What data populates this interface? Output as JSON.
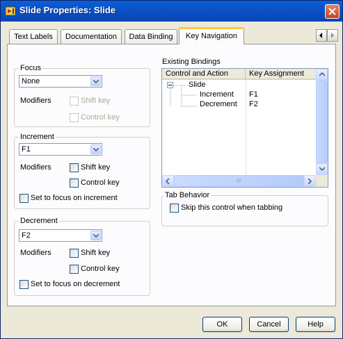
{
  "window": {
    "title": "Slide Properties: Slide"
  },
  "tabs": [
    {
      "label": "Text Labels"
    },
    {
      "label": "Documentation"
    },
    {
      "label": "Data Binding"
    },
    {
      "label": "Key Navigation",
      "selected": true
    }
  ],
  "focus": {
    "label": "Focus",
    "select_value": "None",
    "modifiers_label": "Modifiers",
    "shift_key": "Shift key",
    "control_key": "Control key"
  },
  "increment": {
    "label": "Increment",
    "select_value": "F1",
    "modifiers_label": "Modifiers",
    "shift_key": "Shift key",
    "control_key": "Control key",
    "set_focus": "Set to focus on increment"
  },
  "decrement": {
    "label": "Decrement",
    "select_value": "F2",
    "modifiers_label": "Modifiers",
    "shift_key": "Shift key",
    "control_key": "Control key",
    "set_focus": "Set to focus on decrement"
  },
  "bindings": {
    "label": "Existing Bindings",
    "columns": [
      "Control and Action",
      "Key Assignment"
    ],
    "tree_root": "Slide",
    "rows": [
      {
        "action": "Increment",
        "key": "F1"
      },
      {
        "action": "Decrement",
        "key": "F2"
      }
    ],
    "scroll_grip": "III"
  },
  "tab_behavior": {
    "label": "Tab Behavior",
    "skip_label": "Skip this control when tabbing"
  },
  "buttons": {
    "ok": "OK",
    "cancel": "Cancel",
    "help": "Help"
  },
  "colors": {
    "title_bar": "#0a52c8",
    "active_tab_accent": "#ffc83c",
    "dialog_bg": "#ece9d8"
  }
}
